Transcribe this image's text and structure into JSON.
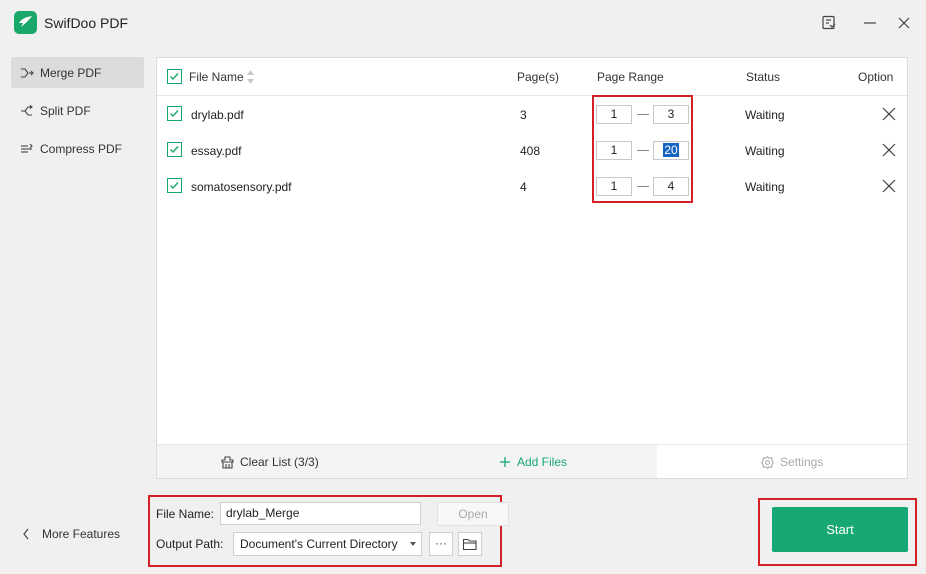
{
  "app": {
    "title": "SwifDoo PDF"
  },
  "sidebar": {
    "items": [
      {
        "label": "Merge PDF",
        "icon": "merge-icon",
        "active": true
      },
      {
        "label": "Split PDF",
        "icon": "split-icon",
        "active": false
      },
      {
        "label": "Compress PDF",
        "icon": "compress-icon",
        "active": false
      }
    ],
    "more_features": "More Features"
  },
  "table": {
    "headers": {
      "file_name": "File Name",
      "pages": "Page(s)",
      "page_range": "Page Range",
      "status": "Status",
      "option": "Option"
    },
    "rows": [
      {
        "file": "drylab.pdf",
        "pages": "3",
        "from": "1",
        "to": "3",
        "status": "Waiting"
      },
      {
        "file": "essay.pdf",
        "pages": "408",
        "from": "1",
        "to": "20",
        "status": "Waiting"
      },
      {
        "file": "somatosensory.pdf",
        "pages": "4",
        "from": "1",
        "to": "4",
        "status": "Waiting"
      }
    ]
  },
  "footer": {
    "clear_list": "Clear List (3/3)",
    "add_files": "Add Files",
    "settings": "Settings"
  },
  "output": {
    "file_name_label": "File Name:",
    "file_name_value": "drylab_Merge",
    "open_label": "Open",
    "output_path_label": "Output Path:",
    "output_path_value": "Document's Current Directory",
    "more_label": "···"
  },
  "start_label": "Start",
  "colors": {
    "accent": "#18a874",
    "highlight": "#d32027",
    "selection": "#1565c0"
  }
}
